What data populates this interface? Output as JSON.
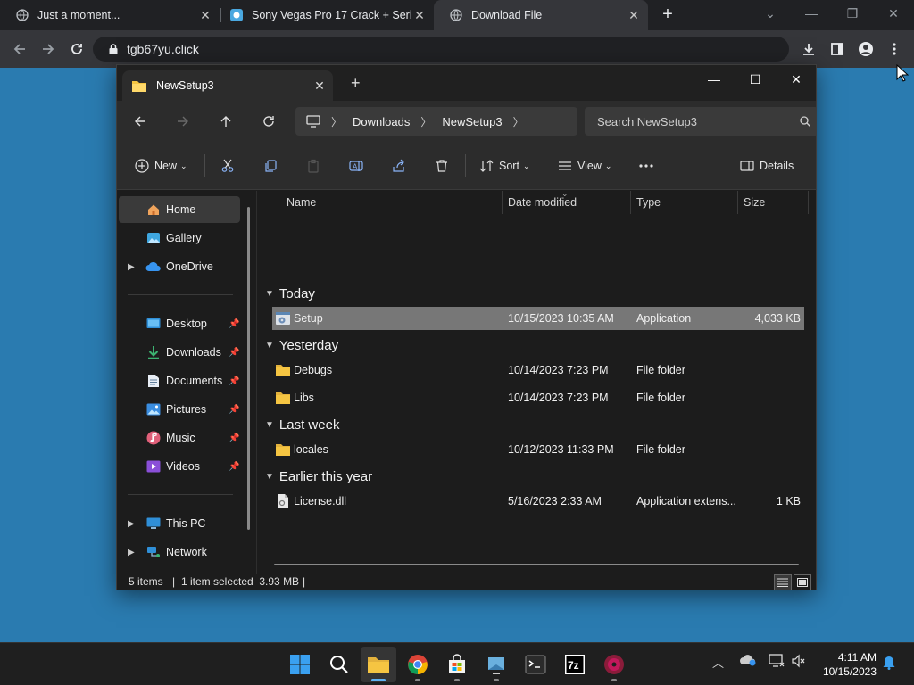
{
  "browser": {
    "tabs": [
      {
        "title": "Just a moment...",
        "active": false
      },
      {
        "title": "Sony Vegas Pro 17 Crack + Serial",
        "active": false
      },
      {
        "title": "Download File",
        "active": true
      }
    ],
    "url": "tgb67yu.click"
  },
  "explorer": {
    "tab_title": "NewSetup3",
    "breadcrumb": [
      "Downloads",
      "NewSetup3"
    ],
    "search_placeholder": "Search NewSetup3",
    "commands": {
      "new": "New",
      "sort": "Sort",
      "view": "View",
      "details": "Details"
    },
    "sidebar": {
      "home": "Home",
      "gallery": "Gallery",
      "onedrive": "OneDrive",
      "desktop": "Desktop",
      "downloads": "Downloads",
      "documents": "Documents",
      "pictures": "Pictures",
      "music": "Music",
      "videos": "Videos",
      "thispc": "This PC",
      "network": "Network"
    },
    "columns": {
      "name": "Name",
      "date": "Date modified",
      "type": "Type",
      "size": "Size"
    },
    "groups": {
      "today": "Today",
      "yesterday": "Yesterday",
      "lastweek": "Last week",
      "earlier": "Earlier this year"
    },
    "files": {
      "setup": {
        "name": "Setup",
        "date": "10/15/2023 10:35 AM",
        "type": "Application",
        "size": "4,033 KB"
      },
      "debugs": {
        "name": "Debugs",
        "date": "10/14/2023 7:23 PM",
        "type": "File folder",
        "size": ""
      },
      "libs": {
        "name": "Libs",
        "date": "10/14/2023 7:23 PM",
        "type": "File folder",
        "size": ""
      },
      "locales": {
        "name": "locales",
        "date": "10/12/2023 11:33 PM",
        "type": "File folder",
        "size": ""
      },
      "license": {
        "name": "License.dll",
        "date": "5/16/2023 2:33 AM",
        "type": "Application extens...",
        "size": "1 KB"
      }
    },
    "status": {
      "items": "5 items",
      "selected": "1 item selected  3.93 MB"
    }
  },
  "taskbar": {
    "time": "4:11 AM",
    "date": "10/15/2023"
  },
  "colors": {
    "desktop": "#2a7bb0",
    "selection": "#777777",
    "accent": "#5fb2f2",
    "folder": "#f5c542"
  }
}
